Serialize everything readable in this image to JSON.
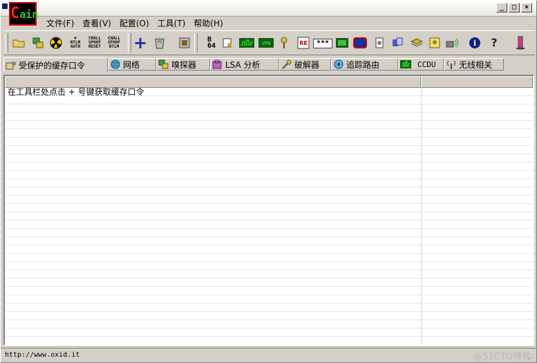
{
  "app": {
    "logo_text": "ain",
    "logo_c": "C",
    "window_buttons": [
      "_",
      "□",
      "×"
    ]
  },
  "menu": [
    "文件(F)",
    "查看(V)",
    "配置(O)",
    "工具(T)",
    "帮助(H)"
  ],
  "toolbar": {
    "buttons": [
      {
        "name": "open-folder-icon",
        "glyph": "📂"
      },
      {
        "name": "network-adapter-icon",
        "glyph": "🖧"
      },
      {
        "name": "radiation-icon",
        "glyph": "☢"
      },
      {
        "name": "ntlm-auth-icon",
        "text": "NTLM\nAUTH"
      },
      {
        "name": "chall-spoof-reset-icon",
        "text": "CHALL\nSPOOF\nRESET"
      },
      {
        "name": "chall-spoof-ntlm-icon",
        "text": "CHALL\nSPOOF\nNTLM"
      },
      {
        "name": "add-icon",
        "glyph": "+"
      },
      {
        "name": "recycle-bin-icon",
        "glyph": "♻"
      },
      {
        "name": "certificate-icon",
        "glyph": "▦"
      },
      {
        "name": "base64-icon",
        "text": "B\n64"
      },
      {
        "name": "key-password-icon",
        "glyph": "✎"
      },
      {
        "name": "hash-calculator-icon",
        "glyph": "▤"
      },
      {
        "name": "mac-icon",
        "glyph": "▣"
      },
      {
        "name": "key-icon",
        "glyph": "⚷"
      },
      {
        "name": "rdp-icon",
        "glyph": "▩"
      },
      {
        "name": "password-dots-icon",
        "text": "***"
      },
      {
        "name": "terminal-icon",
        "glyph": "▭"
      },
      {
        "name": "routing-icon",
        "glyph": "▢"
      },
      {
        "name": "scanner-icon",
        "glyph": "⚙"
      },
      {
        "name": "sniffer-icon",
        "glyph": "❖"
      },
      {
        "name": "database-icon",
        "glyph": "⛁"
      },
      {
        "name": "lock-key-icon",
        "glyph": "⚿"
      },
      {
        "name": "wireless-icon",
        "glyph": "≋"
      },
      {
        "name": "info-icon",
        "glyph": "i"
      },
      {
        "name": "help-icon",
        "glyph": "?"
      },
      {
        "name": "exit-icon",
        "glyph": "▮"
      }
    ]
  },
  "tabs": [
    {
      "label": "受保护的缓存口令",
      "icon": "cached-password-icon",
      "glyph": "🔑",
      "active": true
    },
    {
      "label": "网络",
      "icon": "network-globe-icon",
      "glyph": "🌐"
    },
    {
      "label": "嗅探器",
      "icon": "sniffer-icon",
      "glyph": "🖧"
    },
    {
      "label": "LSA 分析",
      "icon": "lsa-secrets-icon",
      "glyph": "⚿"
    },
    {
      "label": "破解器",
      "icon": "cracker-key-icon",
      "glyph": "⚷"
    },
    {
      "label": "追踪路由",
      "icon": "traceroute-icon",
      "glyph": "◎"
    },
    {
      "label": "CCDU",
      "icon": "ccdu-icon",
      "glyph": "▦"
    },
    {
      "label": "无线相关",
      "icon": "wireless-antenna-icon",
      "glyph": "📶"
    }
  ],
  "list": {
    "rows": [
      [
        "在工具栏处点击 + 号键获取缓存口令",
        ""
      ]
    ]
  },
  "status": {
    "text": "http://www.oxid.it",
    "watermark": "@51CTO博客"
  }
}
